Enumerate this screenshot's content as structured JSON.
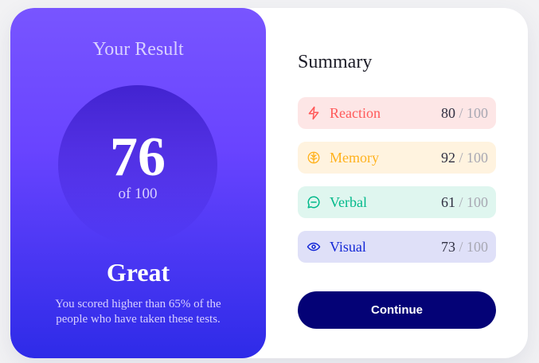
{
  "result": {
    "title": "Your Result",
    "score": "76",
    "score_total": "of 100",
    "rating": "Great",
    "description": "You scored higher than 65% of the people who have taken these tests."
  },
  "summary": {
    "title": "Summary",
    "items": [
      {
        "label": "Reaction",
        "score": "80",
        "max": " / 100",
        "icon": "lightning-icon",
        "color": "#ff5959",
        "background": "#fde6e6"
      },
      {
        "label": "Memory",
        "score": "92",
        "max": " / 100",
        "icon": "brain-icon",
        "color": "#ffb21e",
        "background": "#fff3df"
      },
      {
        "label": "Verbal",
        "score": "61",
        "max": " / 100",
        "icon": "chat-icon",
        "color": "#00b98a",
        "background": "#dff6ef"
      },
      {
        "label": "Visual",
        "score": "73",
        "max": " / 100",
        "icon": "eye-icon",
        "color": "#1125d6",
        "background": "#dfe0f8"
      }
    ],
    "continue_label": "Continue"
  }
}
